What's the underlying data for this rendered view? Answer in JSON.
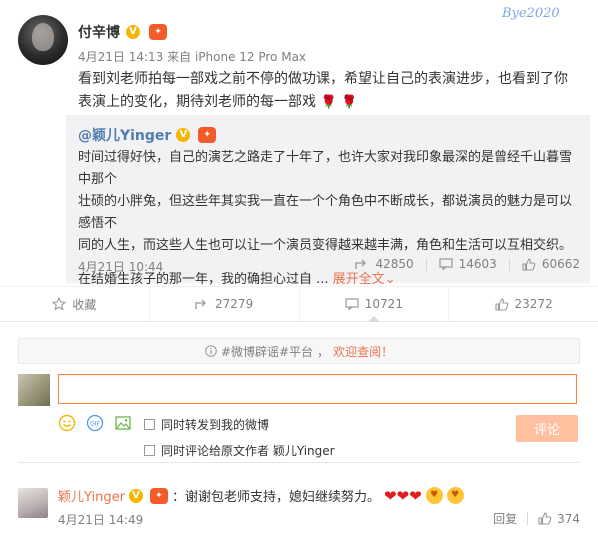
{
  "watermark": "Bye2020",
  "post": {
    "author": "付辛博",
    "verified_mark": "V",
    "vip_mark": "会员",
    "time": "4月21日 14:13",
    "source": "来自 iPhone 12 Pro Max",
    "text_line1": "看到刘老师拍每一部戏之前不停的做功课，希望让自己的表演进步，也看到了你",
    "text_line2": "表演上的变化，期待刘老师的每一部戏",
    "emoji": "🌹"
  },
  "repost": {
    "author": "@颖儿Yinger",
    "verified_mark": "V",
    "vip_mark": "会员",
    "line1": "时间过得好快，自己的演艺之路走了十年了，也许大家对我印象最深的是曾经千山暮雪中那个",
    "line2": "壮硕的小胖兔，但这些年其实我一直在一个个角色中不断成长，都说演员的魅力是可以感悟不",
    "line3": "同的人生，而这些人生也可以让一个演员变得越来越丰满，角色和生活可以互相交织。",
    "line4": "在结婚生孩子的那一年，我的确担心过自 ...",
    "expand": "展开全文",
    "expand_arrow": "⌄",
    "time": "4月21日 10:44",
    "share_count": "42850",
    "comment_count": "14603",
    "like_count": "60662"
  },
  "actions": {
    "favorite": "收藏",
    "repost": "27279",
    "comment": "10721",
    "like": "23272"
  },
  "notice": {
    "tag": "#微博辟谣#平台",
    "sep": "，",
    "link": "欢迎查阅！"
  },
  "compose": {
    "input_value": "",
    "option_repost": "同时转发到我的微博",
    "option_comment": "同时评论给原文作者 颖儿Yinger",
    "submit": "评论",
    "gif_label": "GIF"
  },
  "comment": {
    "author": "颖儿Yinger",
    "verified_mark": "V",
    "vip_mark": "会员",
    "text": "：谢谢包老师支持，媳妇继续努力。",
    "hearts": "❤❤❤",
    "time": "4月21日 14:49",
    "reply": "回复",
    "like_count": "374"
  },
  "colors": {
    "accent": "#eb7350",
    "link_blue": "#507daf",
    "input_border": "#ff8140",
    "submit_bg": "#ffc09f"
  }
}
